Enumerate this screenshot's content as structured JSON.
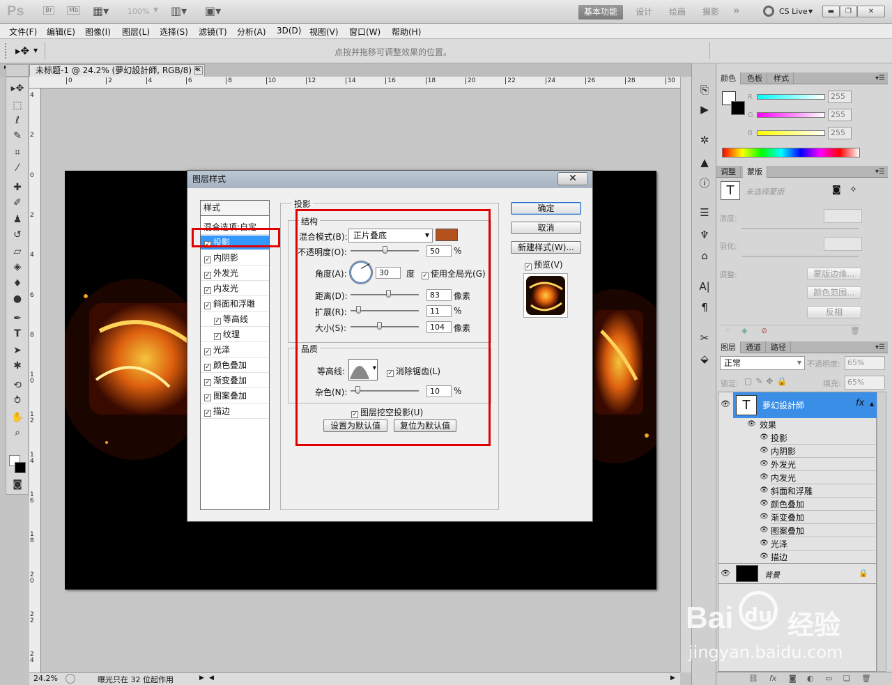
{
  "titlebar": {
    "logo": "Ps",
    "br": "Br",
    "mb": "Mb",
    "zoom": "100%",
    "workspaces": [
      "基本功能",
      "设计",
      "绘画",
      "摄影"
    ],
    "more": "»",
    "cslive": "CS Live"
  },
  "menu": [
    "文件(F)",
    "编辑(E)",
    "图像(I)",
    "图层(L)",
    "选择(S)",
    "滤镜(T)",
    "分析(A)",
    "3D(D)",
    "视图(V)",
    "窗口(W)",
    "帮助(H)"
  ],
  "options": {
    "hint": "点按并拖移可调整效果的位置。"
  },
  "document": {
    "tab_title": "未标题-1 @ 24.2% (夢幻設計師, RGB/8) *",
    "zoom": "24.2%",
    "status": "曝光只在 32 位起作用",
    "hruler": [
      "0",
      "2",
      "4",
      "6",
      "8",
      "10",
      "12",
      "14",
      "16",
      "18",
      "20",
      "22",
      "24",
      "26",
      "28",
      "30"
    ],
    "vruler": [
      "4",
      "2",
      "0",
      "2",
      "4",
      "6",
      "8",
      "1 0",
      "1 2",
      "1 4",
      "1 6",
      "1 8",
      "2 0",
      "2 2",
      "2 4"
    ]
  },
  "color_panel": {
    "tabs": [
      "颜色",
      "色板",
      "样式"
    ],
    "channels": [
      {
        "label": "R",
        "value": "255"
      },
      {
        "label": "G",
        "value": "255"
      },
      {
        "label": "B",
        "value": "255"
      }
    ]
  },
  "adjust_panel": {
    "tabs": [
      "调整",
      "蒙版"
    ],
    "mask_label": "未选择蒙版",
    "density": "浓度:",
    "feather": "羽化:",
    "refine": "调整:",
    "btn_edge": "蒙版边缘...",
    "btn_range": "颜色范围...",
    "btn_invert": "反相"
  },
  "layers_panel": {
    "tabs": [
      "图层",
      "通道",
      "路径"
    ],
    "blend": "正常",
    "opacity_label": "不透明度:",
    "opacity": "65%",
    "lock_label": "锁定:",
    "fill_label": "填充:",
    "fill": "65%",
    "text_layer": "夢幻設計師",
    "fx": "fx",
    "effects_label": "效果",
    "effects": [
      "投影",
      "内阴影",
      "外发光",
      "内发光",
      "斜面和浮雕",
      "颜色叠加",
      "渐变叠加",
      "图案叠加",
      "光泽",
      "描边"
    ],
    "background": "背景"
  },
  "dialog": {
    "title": "图层样式",
    "close": "✕",
    "styles_header": "样式",
    "blend_options": "混合选项:自定",
    "styles": [
      {
        "label": "投影",
        "checked": true,
        "indent": false
      },
      {
        "label": "内阴影",
        "checked": true,
        "indent": false
      },
      {
        "label": "外发光",
        "checked": true,
        "indent": false
      },
      {
        "label": "内发光",
        "checked": true,
        "indent": false
      },
      {
        "label": "斜面和浮雕",
        "checked": true,
        "indent": false
      },
      {
        "label": "等高线",
        "checked": true,
        "indent": true
      },
      {
        "label": "纹理",
        "checked": true,
        "indent": true
      },
      {
        "label": "光泽",
        "checked": true,
        "indent": false
      },
      {
        "label": "颜色叠加",
        "checked": true,
        "indent": false
      },
      {
        "label": "渐变叠加",
        "checked": true,
        "indent": false
      },
      {
        "label": "图案叠加",
        "checked": true,
        "indent": false
      },
      {
        "label": "描边",
        "checked": true,
        "indent": false
      }
    ],
    "section": "投影",
    "structure": "结构",
    "blend_mode_label": "混合模式(B):",
    "blend_mode": "正片叠底",
    "shadow_color": "#b4521e",
    "opacity_label": "不透明度(O):",
    "opacity": "50",
    "percent": "%",
    "angle_label": "角度(A):",
    "angle": "30",
    "degree": "度",
    "global_light": "使用全局光(G)",
    "distance_label": "距离(D):",
    "distance": "83",
    "spread_label": "扩展(R):",
    "spread": "11",
    "size_label": "大小(S):",
    "size": "104",
    "pixels": "像素",
    "quality": "品质",
    "contour_label": "等高线:",
    "antialias": "消除锯齿(L)",
    "noise_label": "杂色(N):",
    "noise": "10",
    "knockout": "图层挖空投影(U)",
    "btn_set_default": "设置为默认值",
    "btn_reset_default": "复位为默认值",
    "btn_ok": "确定",
    "btn_cancel": "取消",
    "btn_new_style": "新建样式(W)...",
    "preview": "预览(V)"
  },
  "watermark": {
    "brand": "Bai",
    "brand2": "du",
    "cn": "经验",
    "url": "jingyan.baidu.com"
  }
}
